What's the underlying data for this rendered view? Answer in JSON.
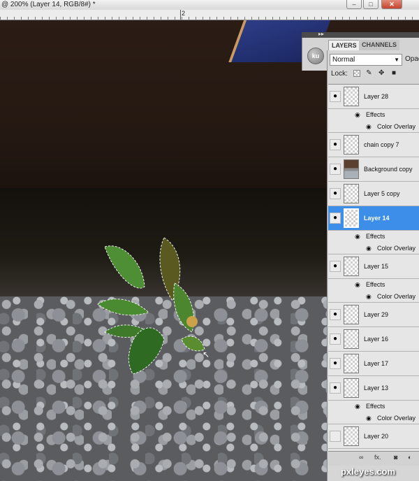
{
  "document": {
    "title": "@ 200% (Layer 14, RGB/8#) *",
    "ruler_mark": "2"
  },
  "window_controls": {
    "minimize": "–",
    "restore": "□",
    "close": "✕"
  },
  "panel": {
    "avatar_text": "ku",
    "tabs": [
      {
        "label": "LAYERS",
        "active": true
      },
      {
        "label": "CHANNELS",
        "active": false
      }
    ],
    "blend_mode": "Normal",
    "opacity_label": "Opac",
    "lock_label": "Lock:",
    "layers": [
      {
        "name": "Layer 28",
        "visible": true,
        "thumb": "transparent",
        "selected": false,
        "effects": [
          "Color Overlay"
        ]
      },
      {
        "name": "chain copy 7",
        "visible": true,
        "thumb": "transparent",
        "selected": false,
        "effects": []
      },
      {
        "name": "Background copy",
        "visible": true,
        "thumb": "photo",
        "selected": false,
        "effects": []
      },
      {
        "name": "Layer 5 copy",
        "visible": true,
        "thumb": "transparent",
        "selected": false,
        "effects": []
      },
      {
        "name": "Layer 14",
        "visible": true,
        "thumb": "transparent",
        "selected": true,
        "effects": [
          "Color Overlay"
        ]
      },
      {
        "name": "Layer 15",
        "visible": true,
        "thumb": "transparent",
        "selected": false,
        "effects": [
          "Color Overlay"
        ]
      },
      {
        "name": "Layer 29",
        "visible": true,
        "thumb": "transparent",
        "selected": false,
        "effects": []
      },
      {
        "name": "Layer 16",
        "visible": true,
        "thumb": "transparent",
        "selected": false,
        "effects": []
      },
      {
        "name": "Layer 17",
        "visible": true,
        "thumb": "transparent",
        "selected": false,
        "effects": []
      },
      {
        "name": "Layer 13",
        "visible": true,
        "thumb": "transparent",
        "selected": false,
        "effects": [
          "Color Overlay"
        ]
      },
      {
        "name": "Layer 20",
        "visible": false,
        "thumb": "transparent",
        "selected": false,
        "effects": []
      }
    ],
    "effects_label": "Effects",
    "footer_fx": "fx."
  },
  "watermark": "pxleyes.com",
  "colors": {
    "selection": "#3d8ee8",
    "panel_bg": "#d6d6d6"
  }
}
